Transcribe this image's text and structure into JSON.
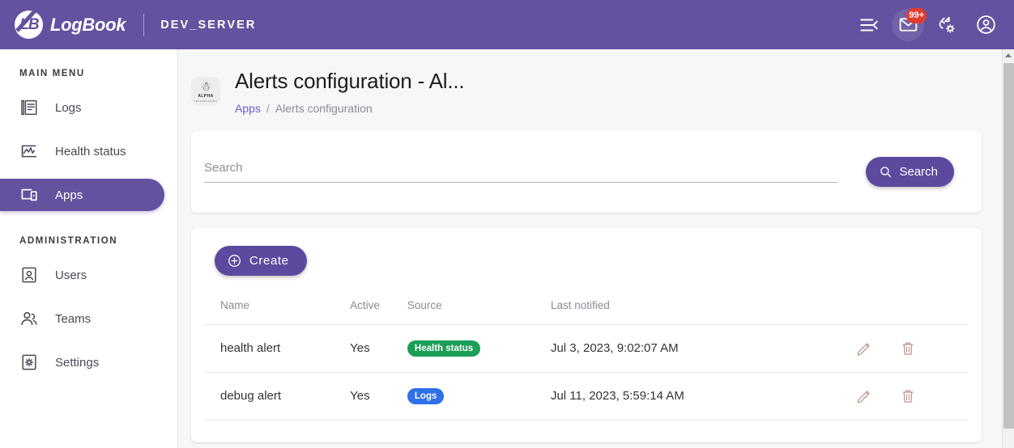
{
  "topbar": {
    "brand_name": "LogBook",
    "brand_mark": "LB",
    "server_name": "DEV_SERVER",
    "actions": [
      {
        "name": "menu-collapse-icon",
        "label": ""
      },
      {
        "name": "mail-icon",
        "label": "",
        "badge": "99+"
      },
      {
        "name": "sync-settings-icon",
        "label": ""
      },
      {
        "name": "account-circle-icon",
        "label": ""
      }
    ],
    "mail_badge": "99+"
  },
  "sidebar": {
    "sections": [
      {
        "title": "MAIN MENU",
        "items": [
          {
            "label": "Logs",
            "icon": "logs-icon",
            "active": false
          },
          {
            "label": "Health status",
            "icon": "health-status-icon",
            "active": false
          },
          {
            "label": "Apps",
            "icon": "apps-devices-icon",
            "active": true
          }
        ]
      },
      {
        "title": "ADMINISTRATION",
        "items": [
          {
            "label": "Users",
            "icon": "user-badge-icon",
            "active": false
          },
          {
            "label": "Teams",
            "icon": "teams-icon",
            "active": false
          },
          {
            "label": "Settings",
            "icon": "settings-gear-icon",
            "active": false
          }
        ]
      }
    ]
  },
  "page": {
    "title": "Alerts configuration - Al...",
    "avatar_alpha": "ALPHA",
    "avatar_sub": "TECHNOLOGIES",
    "breadcrumb": {
      "root": "Apps",
      "separator": "/",
      "current": "Alerts configuration"
    }
  },
  "search": {
    "placeholder": "Search",
    "value": "",
    "button_label": "Search"
  },
  "toolbar": {
    "create_label": "Create"
  },
  "table": {
    "columns": [
      "Name",
      "Active",
      "Source",
      "Last notified",
      ""
    ],
    "rows": [
      {
        "name": "health alert",
        "active": "Yes",
        "source": "Health status",
        "source_color": "#1b9e57",
        "last_notified": "Jul 3, 2023, 9:02:07 AM"
      },
      {
        "name": "debug alert",
        "active": "Yes",
        "source": "Logs",
        "source_color": "#2f6fe8",
        "last_notified": "Jul 11, 2023, 5:59:14 AM"
      }
    ]
  },
  "colors": {
    "primary": "#64519f",
    "button": "#5d4a9e",
    "link": "#6a5acd",
    "row_icon": "#c49c97",
    "badge_red": "#e23b30",
    "page_bg": "#f7f7f9"
  }
}
